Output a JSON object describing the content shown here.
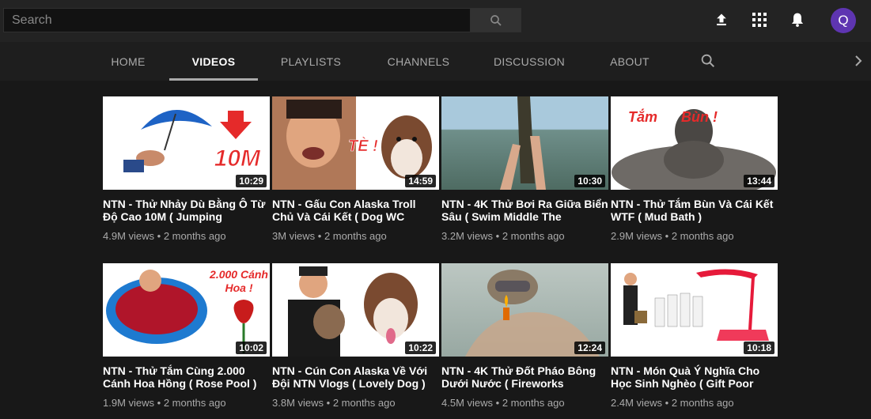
{
  "search": {
    "placeholder": "Search"
  },
  "header": {
    "avatar_letter": "Q",
    "accent": "#5e35b1"
  },
  "icons": [
    "search-icon",
    "upload-icon",
    "apps-icon",
    "bell-icon",
    "chevron-right-icon"
  ],
  "tabs": [
    {
      "label": "HOME",
      "active": false
    },
    {
      "label": "VIDEOS",
      "active": true
    },
    {
      "label": "PLAYLISTS",
      "active": false
    },
    {
      "label": "CHANNELS",
      "active": false
    },
    {
      "label": "DISCUSSION",
      "active": false
    },
    {
      "label": "ABOUT",
      "active": false
    }
  ],
  "videos": [
    {
      "title": "NTN - Thử Nhảy Dù Bằng Ô Từ Độ Cao 10M ( Jumping",
      "views": "4.9M views",
      "age": "2 months ago",
      "duration": "10:29",
      "overlay": "10M"
    },
    {
      "title": "NTN - Gấu Con Alaska Troll Chủ Và Cái Kết ( Dog WC",
      "views": "3M views",
      "age": "2 months ago",
      "duration": "14:59",
      "overlay": "TÈ !"
    },
    {
      "title": "NTN - 4K Thử Bơi Ra Giữa Biển Sâu ( Swim Middle The",
      "views": "3.2M views",
      "age": "2 months ago",
      "duration": "10:30",
      "overlay": ""
    },
    {
      "title": "NTN - Thử Tắm Bùn Và Cái Kết WTF ( Mud Bath )",
      "views": "2.9M views",
      "age": "2 months ago",
      "duration": "13:44",
      "overlay": "Tắm      Bùn !"
    },
    {
      "title": "NTN - Thử Tắm Cùng 2.000 Cánh Hoa Hồng ( Rose Pool )",
      "views": "1.9M views",
      "age": "2 months ago",
      "duration": "10:02",
      "overlay": "2.000 Cánh Hoa !"
    },
    {
      "title": "NTN - Cún Con Alaska Về Với Đội NTN Vlogs ( Lovely Dog )",
      "views": "3.8M views",
      "age": "2 months ago",
      "duration": "10:22",
      "overlay": ""
    },
    {
      "title": "NTN - 4K Thử Đốt Pháo Bông Dưới Nước ( Fireworks",
      "views": "4.5M views",
      "age": "2 months ago",
      "duration": "12:24",
      "overlay": ""
    },
    {
      "title": "NTN - Món Quà Ý Nghĩa Cho Học Sinh Nghèo ( Gift Poor",
      "views": "2.4M views",
      "age": "2 months ago",
      "duration": "10:18",
      "overlay": ""
    }
  ]
}
